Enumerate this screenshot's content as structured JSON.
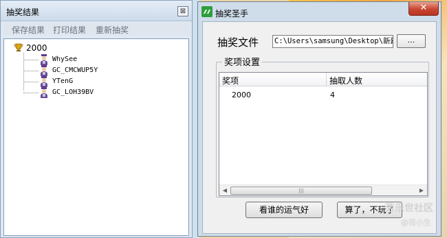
{
  "result_window": {
    "title": "抽奖结果",
    "close_glyph": "⊠",
    "menu": [
      "保存结果",
      "打印结果",
      "重新抽奖"
    ],
    "tree": {
      "root": {
        "label": "2000",
        "icon": "trophy-icon"
      },
      "children": [
        {
          "label": "WhySee",
          "icon": "person-icon"
        },
        {
          "label": "GC_CMCWUP5Y",
          "icon": "person-icon"
        },
        {
          "label": "YTenG",
          "icon": "person-icon"
        },
        {
          "label": "GC_LOH39BV",
          "icon": "person-icon"
        }
      ]
    }
  },
  "main_window": {
    "title": "抽奖圣手",
    "close_glyph": "✕",
    "file_label": "抽奖文件",
    "file_path": "C:\\Users\\samsung\\Desktop\\新建",
    "browse_label": "...",
    "group_title": "奖项设置",
    "list": {
      "columns": [
        "奖项",
        "抽取人数"
      ],
      "rows": [
        {
          "prize": "2000",
          "count": "4"
        }
      ],
      "scroll_left": "◀",
      "scroll_right": "▶",
      "scroll_thumb": "|||"
    },
    "buttons": {
      "luck": "看谁的运气好",
      "quit": "算了，不玩了"
    }
  },
  "watermark": {
    "line1": "芳乐世社区",
    "line2": "@百小生"
  },
  "colors": {
    "accent_close": "#c9452f",
    "tree_border": "#7f9db9"
  }
}
